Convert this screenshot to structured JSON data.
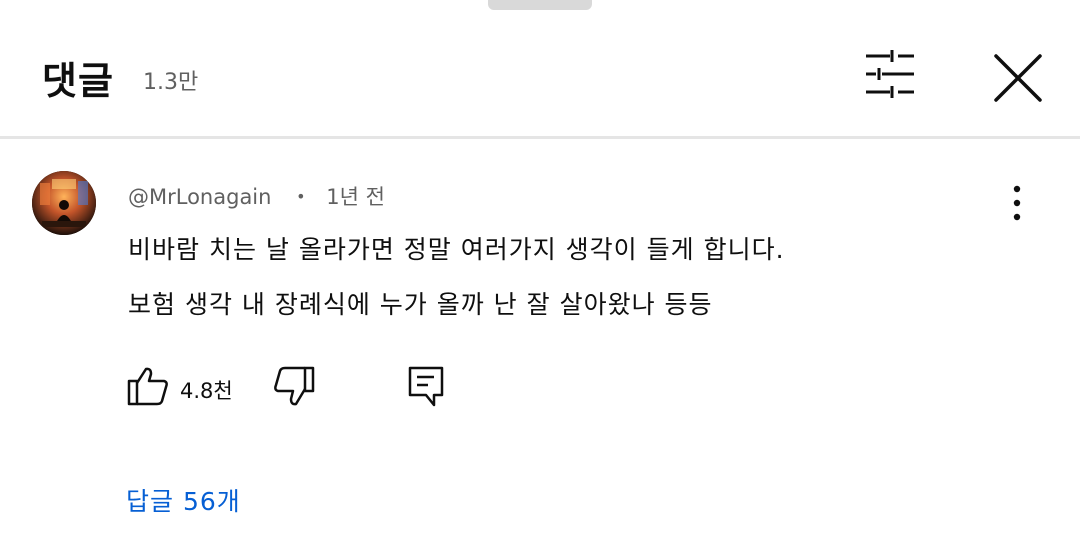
{
  "header": {
    "title": "댓글",
    "count": "1.3만",
    "filter_icon": "sliders-icon",
    "close_icon": "close-icon"
  },
  "comment": {
    "author": "@MrLonagain",
    "separator": "•",
    "time": "1년 전",
    "lines": [
      "비바람 치는 날 올라가면 정말 여러가지 생각이 들게 합니다.",
      "보험 생각 내 장례식에 누가 올까 난 잘 살아왔나 등등"
    ],
    "likes": "4.8천",
    "replies_label": "답글 56개"
  },
  "colors": {
    "link": "#065fd4",
    "secondary_text": "#606060",
    "divider": "#e5e5e5"
  }
}
